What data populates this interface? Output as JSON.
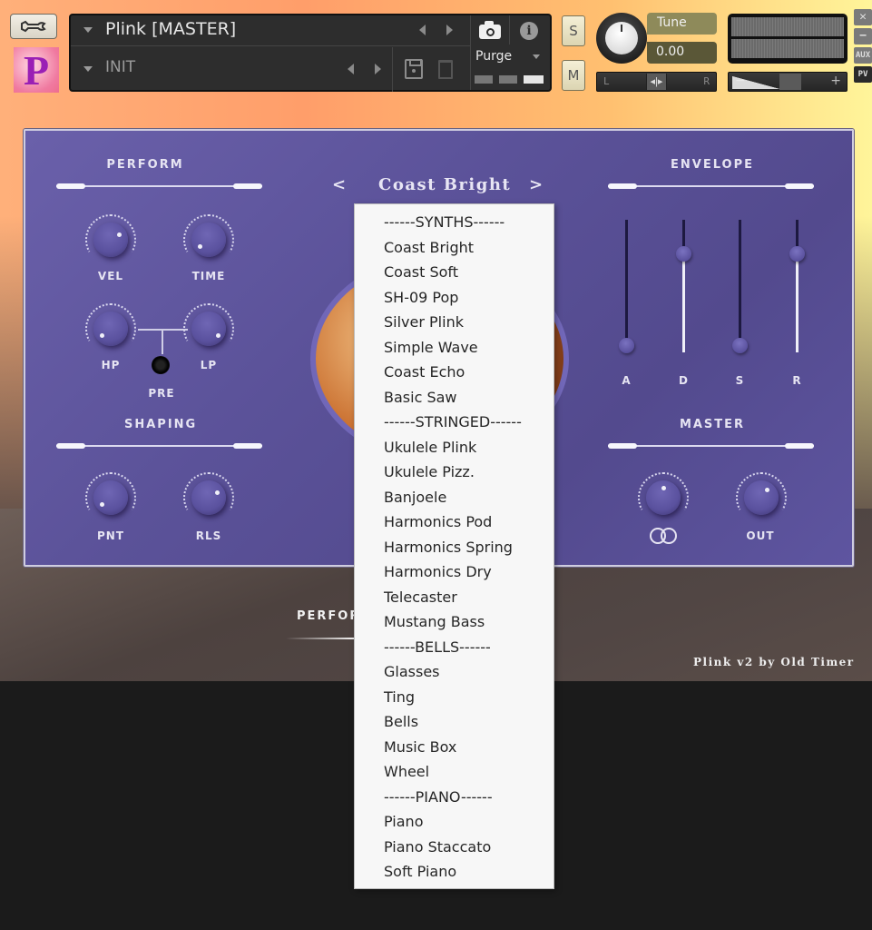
{
  "header": {
    "instrument_name": "Plink [MASTER]",
    "snapshot_name": "INIT",
    "logo_letter": "P",
    "purge_label": "Purge",
    "solo_label": "S",
    "mute_label": "M",
    "tune_label": "Tune",
    "tune_value": "0.00",
    "pan_left_label": "L",
    "pan_right_label": "R",
    "pan_handle_glyph": "◂|▸",
    "volume_minus_label": "−",
    "volume_plus_label": "+",
    "side_buttons": [
      "✕",
      "−",
      "AUX",
      "PV"
    ],
    "icons": [
      "wrench-icon",
      "camera-icon",
      "info-icon",
      "save-icon",
      "trash-icon"
    ]
  },
  "panel": {
    "preset_prev": "<",
    "preset_next": ">",
    "current_preset": "Coast Bright",
    "perform": {
      "title": "PERFORM",
      "knobs": [
        {
          "label": "VEL"
        },
        {
          "label": "TIME"
        },
        {
          "label": "HP"
        },
        {
          "label": "LP"
        }
      ],
      "pre_label": "PRE"
    },
    "shaping": {
      "title": "SHAPING",
      "knobs": [
        {
          "label": "PNT"
        },
        {
          "label": "RLS"
        }
      ]
    },
    "envelope": {
      "title": "ENVELOPE",
      "faders": [
        {
          "label": "A",
          "value": 0.0
        },
        {
          "label": "D",
          "value": 0.75
        },
        {
          "label": "S",
          "value": 0.0
        },
        {
          "label": "R",
          "value": 0.75
        }
      ]
    },
    "master": {
      "title": "MASTER",
      "knobs": [
        {
          "label": "stereo-width"
        },
        {
          "label": "OUT"
        }
      ]
    }
  },
  "footer": {
    "tab_label": "PERFOR",
    "credit": "Plink v2 by Old Timer"
  },
  "dropdown": {
    "items": [
      "------SYNTHS------",
      "Coast Bright",
      "Coast Soft",
      "SH-09 Pop",
      "Silver Plink",
      "Simple Wave",
      "Coast Echo",
      "Basic Saw",
      "------STRINGED------",
      "Ukulele Plink",
      "Ukulele Pizz.",
      "Banjoele",
      "Harmonics Pod",
      "Harmonics Spring",
      "Harmonics Dry",
      "Telecaster",
      "Mustang Bass",
      "------BELLS------",
      "Glasses",
      "Ting",
      "Bells",
      "Music Box",
      "Wheel",
      "------PIANO------",
      "Piano",
      "Piano Staccato",
      "Soft Piano"
    ]
  },
  "colors": {
    "panel_purple": "#5b5299",
    "dropdown_bg": "#f7f7f7",
    "tune_box": "#8e8a5a"
  }
}
